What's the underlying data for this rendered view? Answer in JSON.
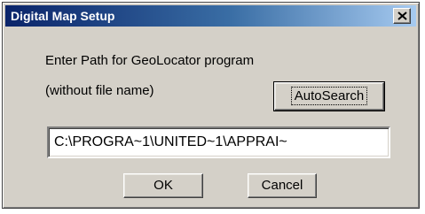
{
  "window": {
    "title": "Digital Map Setup",
    "close_icon": "close-x-icon"
  },
  "dialog": {
    "prompt_line_1": "Enter Path for GeoLocator program",
    "prompt_line_2": "(without file name)",
    "autosearch_label": "AutoSearch",
    "path_value": "C:\\PROGRA~1\\UNITED~1\\APPRAI~",
    "ok_label": "OK",
    "cancel_label": "Cancel"
  },
  "colors": {
    "face": "#d4d0c8",
    "title_start": "#0a246a",
    "title_end": "#a6caf0"
  }
}
